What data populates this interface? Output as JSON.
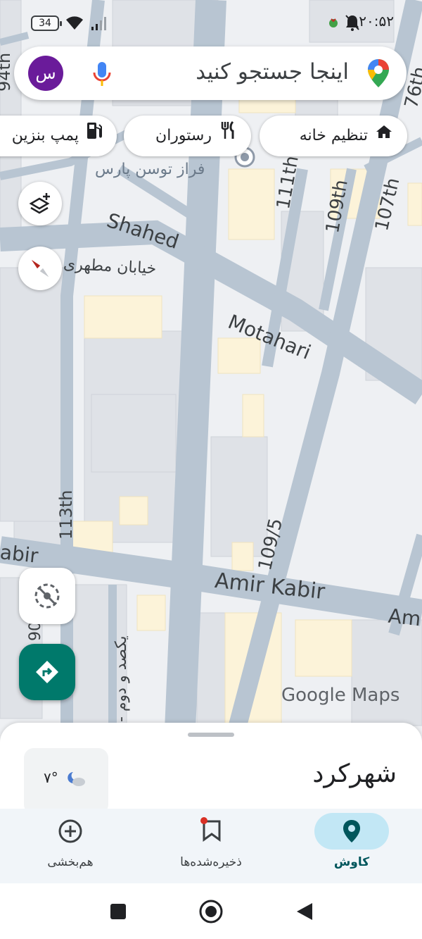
{
  "status_bar": {
    "battery": "34",
    "time": "۲۰:۵۲"
  },
  "search": {
    "placeholder": "اینجا جستجو کنید",
    "avatar_letter": "س"
  },
  "chips": [
    {
      "label": "تنظیم خانه",
      "icon": "home-icon"
    },
    {
      "label": "رستوران",
      "icon": "restaurant-icon"
    },
    {
      "label": "پمپ بنزین",
      "icon": "gas-station-icon"
    }
  ],
  "map": {
    "place_label": "فراز توسن پارس",
    "streets": {
      "shahed": "Shahed",
      "motahari_fa": "خیابان مطهری",
      "motahari": "Motahari",
      "s111": "111th",
      "s109": "109th",
      "s107": "107th",
      "s76": "76th",
      "s113": "113th",
      "s1095": "109/5",
      "amir_kabir": "Amir Kabir",
      "amir_kabir_edge_left": "abir",
      "amir_kabir_edge_right": "Am",
      "s94": "94th",
      "s90": "90",
      "yekso_dovom": "یکصد و دوم -"
    },
    "watermark": "Google Maps"
  },
  "bottom_sheet": {
    "title": "شهرکرد",
    "weather_temp": "۷°"
  },
  "bottom_nav": [
    {
      "label": "کاوش",
      "icon": "explore-pin-icon",
      "active": true
    },
    {
      "label": "ذخیره‌شده‌ها",
      "icon": "bookmark-icon",
      "active": false
    },
    {
      "label": "هم‌بخشی",
      "icon": "contribute-plus-icon",
      "active": false
    }
  ],
  "colors": {
    "map_background": "#e8eaed",
    "road": "#b7c3d0",
    "building": "#dadce0",
    "commercial": "#fdf4d8",
    "directions_fab": "#00796b",
    "nav_active_pill": "#c2e7f5",
    "avatar": "#6a1b9a"
  }
}
